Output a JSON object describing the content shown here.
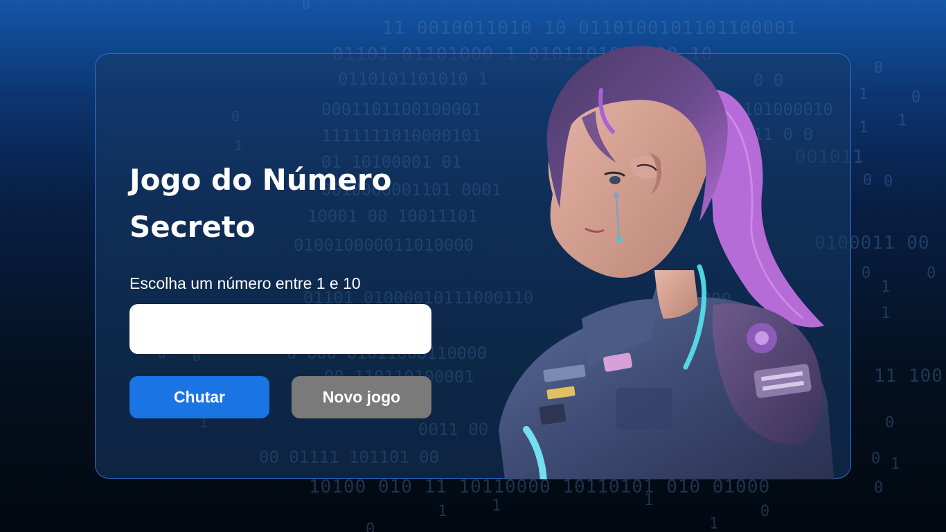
{
  "game": {
    "title_line1": "Jogo do Número",
    "title_line2": "Secreto",
    "subtitle": "Escolha um número entre 1 e 10",
    "input_value": "",
    "guess_button_label": "Chutar",
    "new_game_button_label": "Novo jogo"
  },
  "colors": {
    "accent": "#1b74e4",
    "secondary_button": "#7a7a7a",
    "card_border": "#2b6fd6",
    "background_top": "#1456a8",
    "background_bottom": "#020810"
  }
}
